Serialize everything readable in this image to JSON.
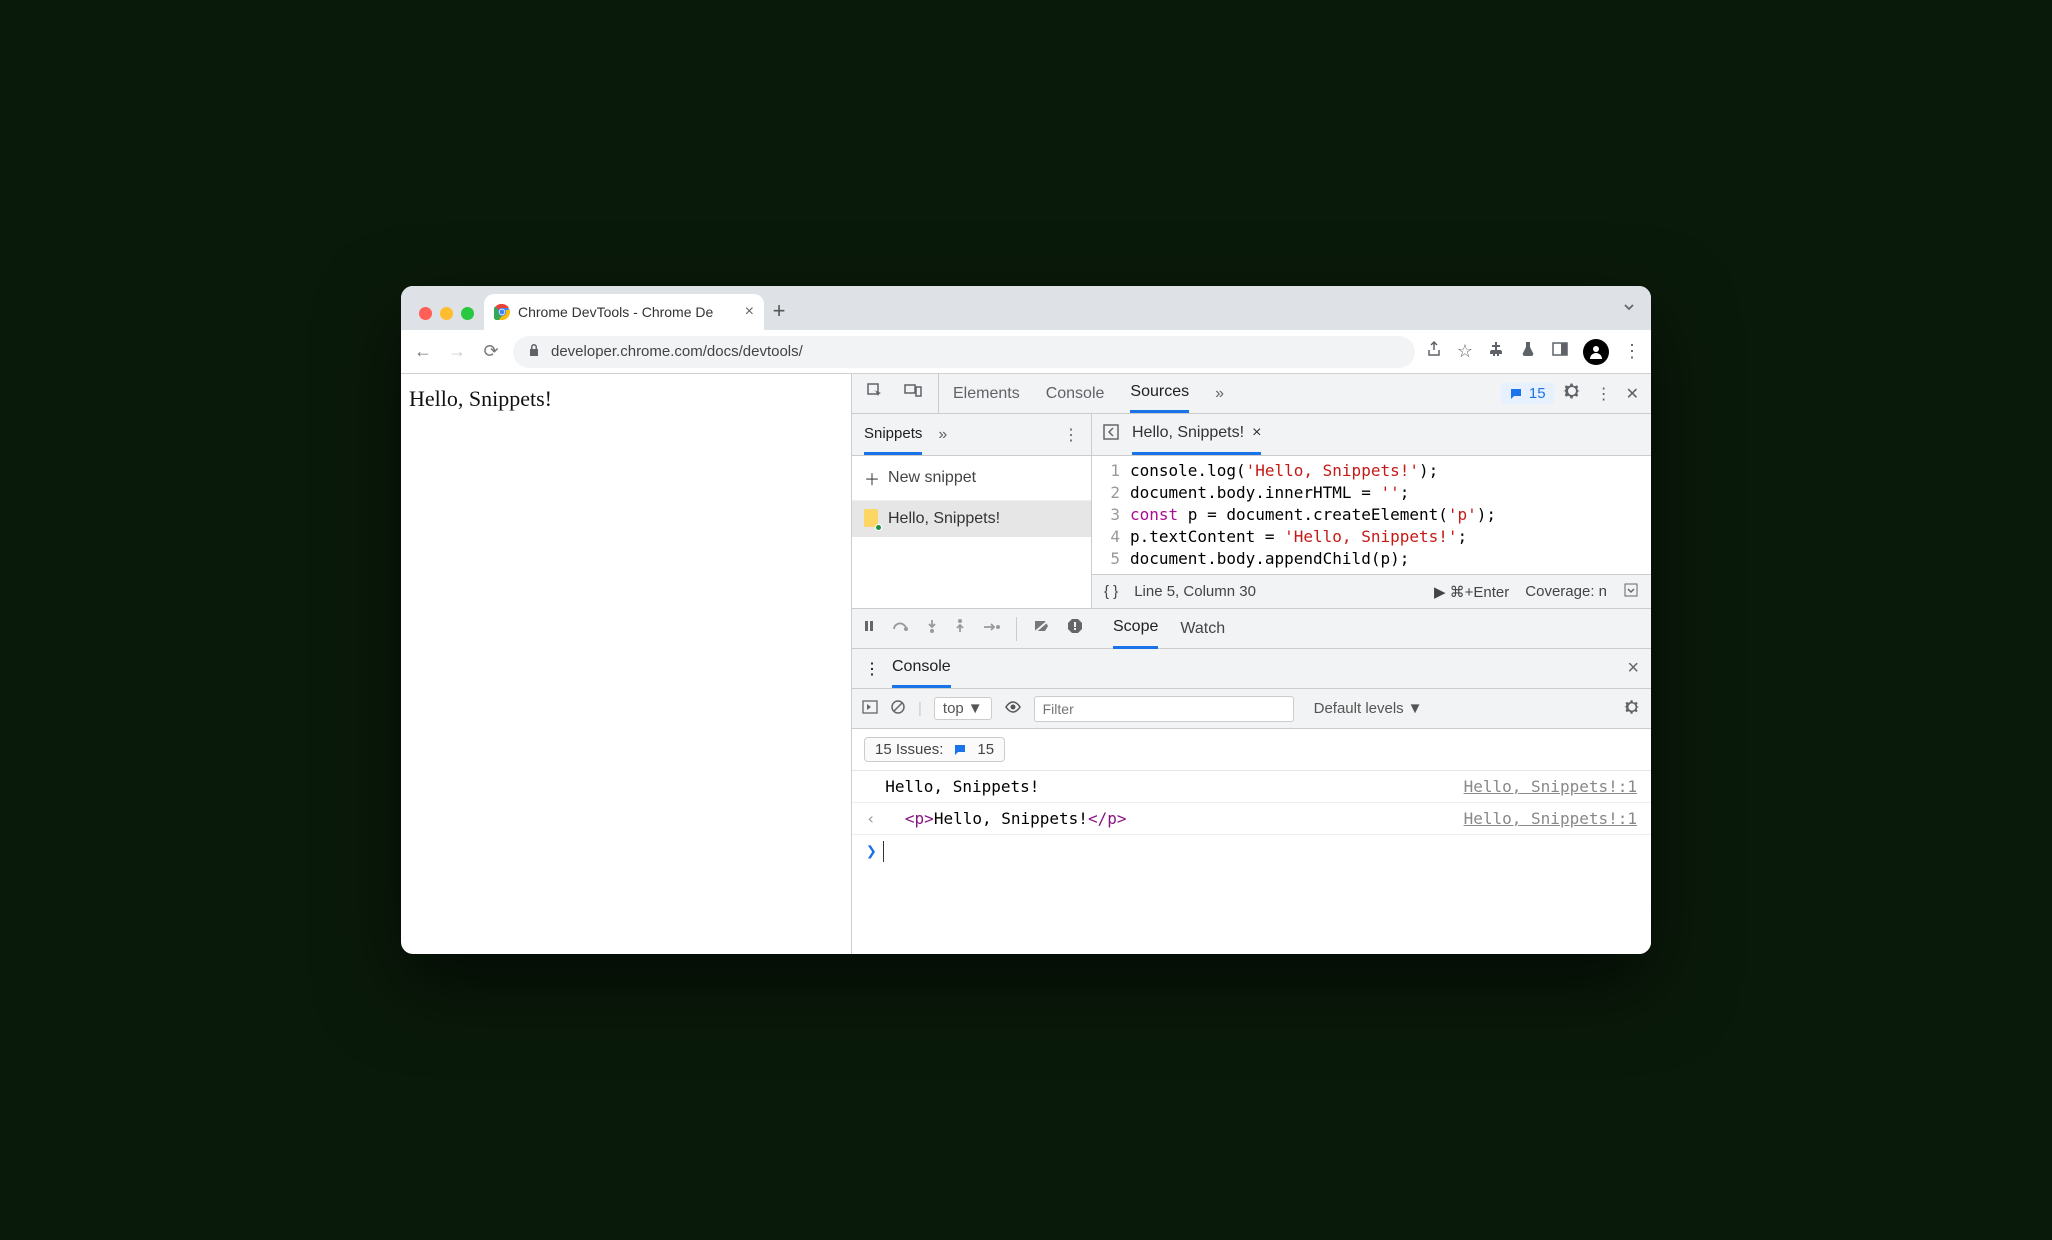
{
  "browser": {
    "tab_title": "Chrome DevTools - Chrome De",
    "url_display": "developer.chrome.com/docs/devtools/",
    "toolbar_icons": [
      "share-icon",
      "star-icon",
      "extensions-icon",
      "labs-icon",
      "sidepanel-icon",
      "account-icon",
      "menu-icon"
    ]
  },
  "page": {
    "body_text": "Hello, Snippets!"
  },
  "devtools": {
    "tabs": [
      "Elements",
      "Console",
      "Sources"
    ],
    "active_tab": "Sources",
    "issues_badge": "15",
    "snippets": {
      "tab_label": "Snippets",
      "new_label": "New snippet",
      "items": [
        "Hello, Snippets!"
      ]
    },
    "editor": {
      "filename": "Hello, Snippets!",
      "code_lines": [
        {
          "n": 1,
          "plain": "console.log(",
          "str": "'Hello, Snippets!'",
          "tail": ");"
        },
        {
          "n": 2,
          "plain": "document.body.innerHTML = ",
          "str": "''",
          "tail": ";"
        },
        {
          "n": 3,
          "kw": "const",
          "plain": " p = document.createElement(",
          "str": "'p'",
          "tail": ");"
        },
        {
          "n": 4,
          "plain": "p.textContent = ",
          "str": "'Hello, Snippets!'",
          "tail": ";"
        },
        {
          "n": 5,
          "plain": "document.body.appendChild(p);",
          "str": "",
          "tail": ""
        }
      ],
      "status": {
        "pos": "Line 5, Column 30",
        "run": "⌘+Enter",
        "coverage": "Coverage: n"
      }
    },
    "debugger_tabs": [
      "Scope",
      "Watch"
    ],
    "drawer": {
      "title": "Console",
      "context": "top",
      "filter_placeholder": "Filter",
      "levels": "Default levels",
      "issues_label": "15 Issues:",
      "issues_count": "15",
      "logs": [
        {
          "text": "Hello, Snippets!",
          "loc": "Hello, Snippets!:1",
          "html": false
        },
        {
          "text": "Hello, Snippets!",
          "loc": "Hello, Snippets!:1",
          "html": true
        }
      ]
    }
  }
}
